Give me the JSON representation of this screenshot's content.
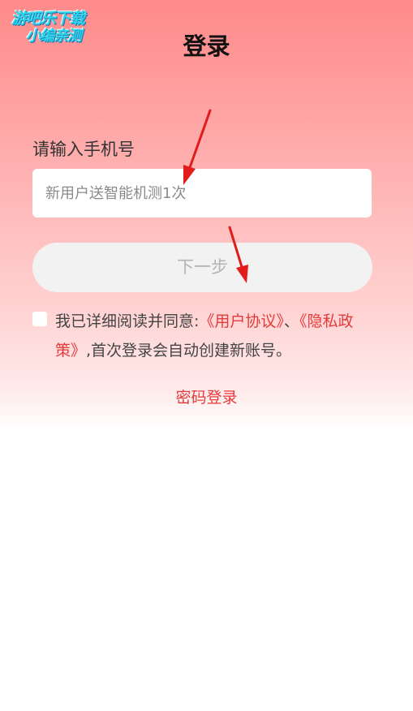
{
  "watermark": {
    "line1": "游吧乐下载",
    "line2": "小编亲测"
  },
  "header": {
    "title": "登录"
  },
  "login": {
    "phone_label": "请输入手机号",
    "phone_placeholder": "新用户送智能机测1次",
    "next_button": "下一步",
    "agreement": {
      "prefix": "我已详细阅读并同意:",
      "user_agreement": "《用户协议》",
      "separator": "、",
      "privacy_policy": "《隐私政策》",
      "suffix": ",首次登录会自动创建新账号。"
    },
    "password_login": "密码登录"
  },
  "colors": {
    "accent": "#e53a3a",
    "gradient_top": "#ff8a8a",
    "annotation_arrow": "#e21b1b"
  }
}
